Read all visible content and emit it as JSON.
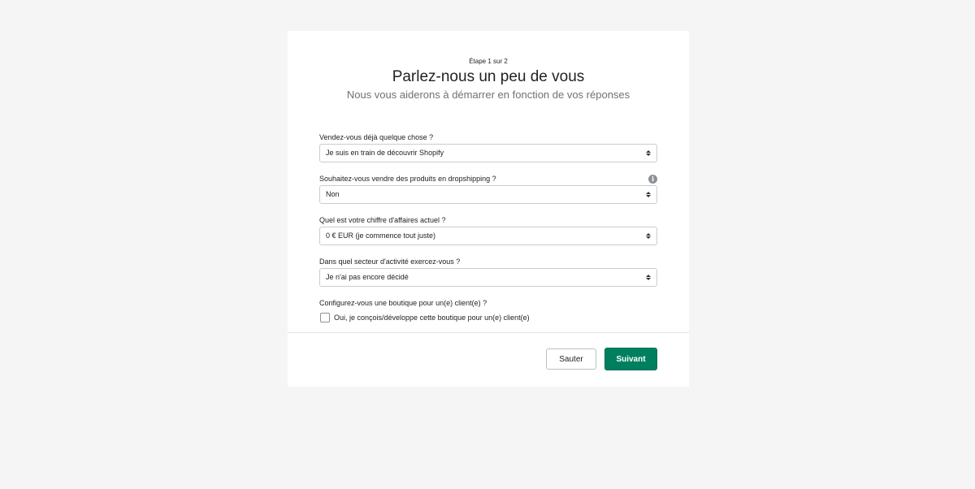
{
  "header": {
    "step": "Étape 1 sur 2",
    "title": "Parlez-nous un peu de vous",
    "subtitle": "Nous vous aiderons à démarrer en fonction de vos réponses"
  },
  "fields": [
    {
      "label": "Vendez-vous déjà quelque chose ?",
      "value": "Je suis en train de découvrir Shopify"
    },
    {
      "label": "Souhaitez-vous vendre des produits en dropshipping ?",
      "value": "Non"
    },
    {
      "label": "Quel est votre chiffre d'affaires actuel ?",
      "value": "0 € EUR (je commence tout juste)"
    },
    {
      "label": "Dans quel secteur d'activité exercez-vous ?",
      "value": "Je n'ai pas encore décidé"
    }
  ],
  "client": {
    "label": "Configurez-vous une boutique pour un(e) client(e) ?",
    "checkbox_label": "Oui, je conçois/développe cette boutique pour un(e) client(e)",
    "checked": false
  },
  "footer": {
    "skip_label": "Sauter",
    "next_label": "Suivant"
  },
  "colors": {
    "primary": "#007f5f",
    "background": "#f5f5f5"
  },
  "icons": {
    "info": "info-icon",
    "select_arrows": "chevron-updown-icon"
  }
}
